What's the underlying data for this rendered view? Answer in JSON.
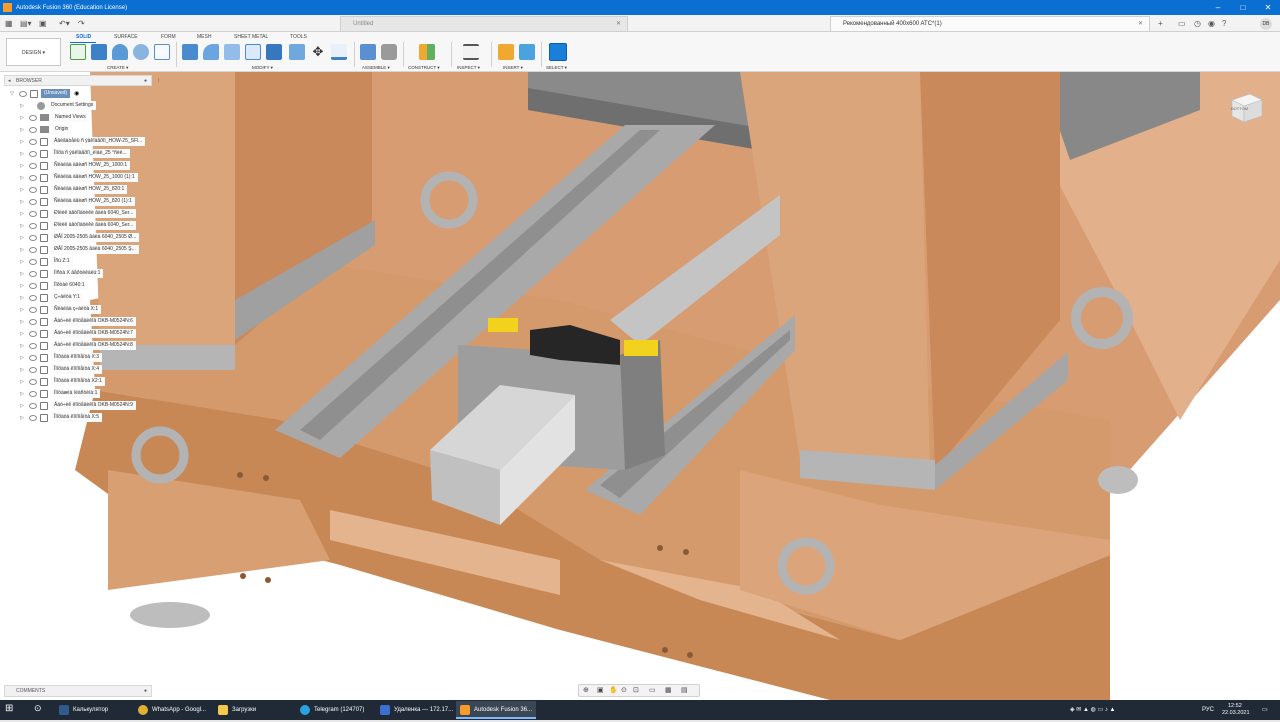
{
  "window": {
    "title": "Autodesk Fusion 360 (Education License)"
  },
  "tabs": [
    {
      "label": "Untitled",
      "active": false
    },
    {
      "label": "Рекомендованный 400x600 ATC*(1)",
      "active": true
    }
  ],
  "user_initials": "DB",
  "toolbar": {
    "design_label": "DESIGN ▾",
    "workspace_tabs": [
      "SOLID",
      "SURFACE",
      "FORM",
      "MESH",
      "SHEET METAL",
      "TOOLS"
    ],
    "groups": [
      "CREATE ▾",
      "MODIFY ▾",
      "ASSEMBLE ▾",
      "CONSTRUCT ▾",
      "INSPECT ▾",
      "INSERT ▾",
      "SELECT ▾"
    ]
  },
  "browser": {
    "title": "BROWSER",
    "rows": [
      {
        "label": "(Unsaved)",
        "type": "root"
      },
      {
        "label": "Document Settings",
        "type": "gear"
      },
      {
        "label": "Named Views",
        "type": "folder"
      },
      {
        "label": "Origin",
        "type": "folder"
      },
      {
        "label": "Äâèãàòåëü ñ ýäêîäåðîì_HOW-25_SFl...",
        "type": "comp"
      },
      {
        "label": "Îïîðà ñ ýäêîäåðîì_èìáë_25 °ñèë...",
        "type": "comp"
      },
      {
        "label": "Ñëàéäà àâèøñ HOW_25_1000:1",
        "type": "comp"
      },
      {
        "label": "Ñëàéäà àâèøñ HOW_25_1000 (1):1",
        "type": "comp"
      },
      {
        "label": "Ñëàéäà àâèøñ HOW_25_820:1",
        "type": "comp"
      },
      {
        "label": "Ñëàéäà àâèøñ HOW_25_820 (1):1",
        "type": "comp"
      },
      {
        "label": "Ðîëèê àâòîìàòèêè âàëà 6040_Ser...",
        "type": "comp"
      },
      {
        "label": "Ðîëèê àâòîìàòèêè âàëà 6040_Ser...",
        "type": "comp"
      },
      {
        "label": "ØÂÏ 2005-2505 âàëà 6040_2505 Ø...",
        "type": "comp"
      },
      {
        "label": "ØÂÏ 2005-2505 âàëà 6040_2505 Ş...",
        "type": "comp"
      },
      {
        "label": "Îñü Z:1",
        "type": "comp"
      },
      {
        "label": "Ìîñòà X âåðòèêàëü:1",
        "type": "comp"
      },
      {
        "label": "Ïîðòàë 6040:1",
        "type": "comp"
      },
      {
        "label": "Ç÷àëòà Y:1",
        "type": "comp"
      },
      {
        "label": "Ñëàéäà ç÷àëòà X:1",
        "type": "comp"
      },
      {
        "label": "Äàò÷èê êîíöåâèêîâ OKB-M0524N:6",
        "type": "comp"
      },
      {
        "label": "Äàò÷èê êîíöåâèêîâ OKB-M0524N:7",
        "type": "comp"
      },
      {
        "label": "Äàò÷èê êîíöåâèêîâ OKB-M0524N:8",
        "type": "comp"
      },
      {
        "label": "Îïîðàòà êîìïîíåíòà X:3",
        "type": "comp"
      },
      {
        "label": "Îïîðàòà êîìïîíåíòà X:4",
        "type": "comp"
      },
      {
        "label": "Îïîðàòà êîìïîíåíòà X2:1",
        "type": "comp"
      },
      {
        "label": "Ìîíòàæíà ïëàñòèíà:1",
        "type": "comp"
      },
      {
        "label": "Äàò÷èê êîíöåâèêîâ OKB-M0524N:9",
        "type": "comp"
      },
      {
        "label": "Îïîðàòà êîìïîíåíòà X:5",
        "type": "comp"
      }
    ]
  },
  "comments_label": "COMMENTS",
  "viewcube_label": "BOTTOM",
  "taskbar": {
    "items": [
      "Калькулятор",
      "WhatsApp - Googl...",
      "Загрузки",
      "Telegram (124707)",
      "Удаленка — 172.17...",
      "Autodesk Fusion 36..."
    ],
    "language": "РУС",
    "time": "12:52",
    "date": "22.03.2021"
  },
  "colors": {
    "accent": "#0a6fd0",
    "wood": "#dca882",
    "steel": "#c8c8c8"
  }
}
